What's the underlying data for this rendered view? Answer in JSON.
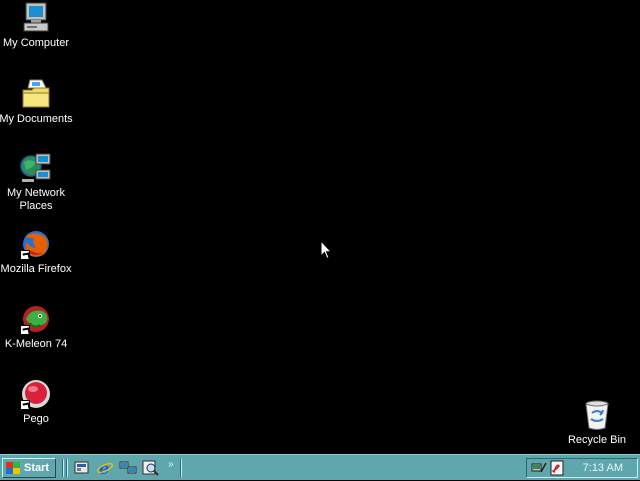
{
  "desktop": {
    "icons": [
      {
        "label": "My Computer",
        "icon": "computer-icon"
      },
      {
        "label": "My Documents",
        "icon": "folder-documents-icon"
      },
      {
        "label": "My Network Places",
        "icon": "network-places-icon"
      },
      {
        "label": "Mozilla Firefox",
        "icon": "firefox-icon",
        "shortcut": true
      },
      {
        "label": "K-Meleon 74",
        "icon": "k-meleon-icon",
        "shortcut": true
      },
      {
        "label": "Pego",
        "icon": "pego-icon",
        "shortcut": true
      },
      {
        "label": "Recycle Bin",
        "icon": "recycle-bin-icon"
      }
    ]
  },
  "taskbar": {
    "start_label": "Start",
    "quick_launch": [
      "show-desktop-icon",
      "internet-explorer-icon",
      "network-icon",
      "search-icon"
    ],
    "overflow_label": "»",
    "tray_icons": [
      "network-status-icon",
      "pdf-reader-icon"
    ],
    "clock": "7:13 AM"
  },
  "colors": {
    "desktop": "#000000",
    "taskbar": "#5fa7ad",
    "label_text": "#ffffff"
  }
}
